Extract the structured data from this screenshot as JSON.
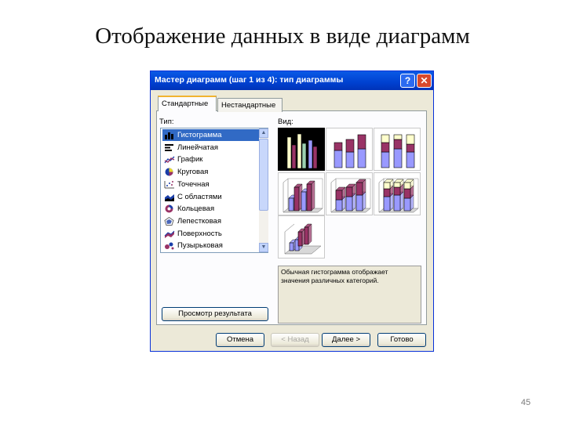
{
  "slide": {
    "title": "Отображение данных в виде диаграмм",
    "page_number": "45"
  },
  "dialog": {
    "title": "Мастер диаграмм (шаг 1 из 4): тип диаграммы",
    "help": "?",
    "close": "✕",
    "tabs": [
      {
        "label": "Стандартные",
        "active": true
      },
      {
        "label": "Нестандартные",
        "active": false
      }
    ],
    "types_label": "Тип:",
    "views_label": "Вид:",
    "chart_types": [
      {
        "label": "Гистограмма",
        "icon": "column-chart-icon",
        "selected": true
      },
      {
        "label": "Линейчатая",
        "icon": "bar-chart-icon",
        "selected": false
      },
      {
        "label": "График",
        "icon": "line-chart-icon",
        "selected": false
      },
      {
        "label": "Круговая",
        "icon": "pie-chart-icon",
        "selected": false
      },
      {
        "label": "Точечная",
        "icon": "scatter-chart-icon",
        "selected": false
      },
      {
        "label": "С областями",
        "icon": "area-chart-icon",
        "selected": false
      },
      {
        "label": "Кольцевая",
        "icon": "doughnut-chart-icon",
        "selected": false
      },
      {
        "label": "Лепестковая",
        "icon": "radar-chart-icon",
        "selected": false
      },
      {
        "label": "Поверхность",
        "icon": "surface-chart-icon",
        "selected": false
      },
      {
        "label": "Пузырьковая",
        "icon": "bubble-chart-icon",
        "selected": false
      }
    ],
    "subtypes": [
      {
        "name": "clustered-column",
        "selected": true
      },
      {
        "name": "stacked-column",
        "selected": false
      },
      {
        "name": "100-stacked-column",
        "selected": false
      },
      {
        "name": "3d-clustered-column",
        "selected": false
      },
      {
        "name": "3d-stacked-column",
        "selected": false
      },
      {
        "name": "3d-100-stacked-column",
        "selected": false
      },
      {
        "name": "3d-column",
        "selected": false
      }
    ],
    "description": "Обычная гистограмма отображает значения различных категорий.",
    "preview_button": "Просмотр результата",
    "buttons": {
      "cancel": "Отмена",
      "back": "< Назад",
      "next": "Далее >",
      "finish": "Готово"
    },
    "colors": {
      "series_primary": "#9999ff",
      "series_secondary": "#993366",
      "series_tertiary": "#ffffcc",
      "selection": "#316ac5",
      "titlebar": "#0a5ae6"
    }
  }
}
